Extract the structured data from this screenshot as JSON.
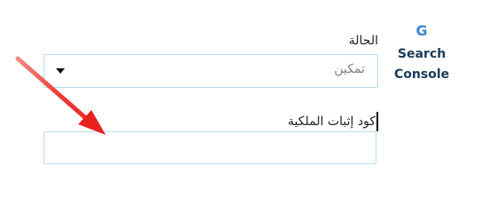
{
  "brand": {
    "icon_letter": "G",
    "line1": "Search",
    "line2": "Console"
  },
  "status_field": {
    "label": "الحالة",
    "selected_value": "تمكين"
  },
  "ownership_field": {
    "label": "كود إثبات الملكية",
    "value": "",
    "placeholder": ""
  },
  "colors": {
    "brand_icon": "#3b87d4",
    "brand_text": "#1c3a58",
    "input_border": "#b8dcef",
    "annotation_arrow": "#e8201e"
  },
  "annotation": {
    "icon": "red-arrow-icon"
  }
}
